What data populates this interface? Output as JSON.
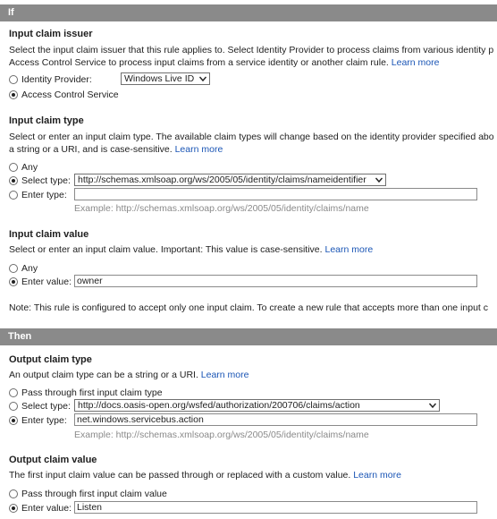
{
  "if_section": {
    "title": "If",
    "issuer": {
      "heading": "Input claim issuer",
      "desc_line1": "Select the input claim issuer that this rule applies to. Select Identity Provider to process claims from various identity p",
      "desc_line2": "Access Control Service to process input claims from a service identity or another claim rule.",
      "learn_more": "Learn more",
      "options": [
        {
          "label": "Identity Provider:",
          "checked": false
        },
        {
          "label": "Access Control Service",
          "checked": true
        }
      ],
      "provider_select": "Windows Live ID"
    },
    "claim_type": {
      "heading": "Input claim type",
      "desc_line1": "Select or enter an input claim type. The available claim types will change based on the identity provider specified abo",
      "desc_line2": "a string or a URI, and is case-sensitive.",
      "learn_more": "Learn more",
      "options": [
        {
          "label": "Any",
          "checked": false
        },
        {
          "label": "Select type:",
          "checked": true
        },
        {
          "label": "Enter type:",
          "checked": false
        }
      ],
      "select_value": "http://schemas.xmlsoap.org/ws/2005/05/identity/claims/nameidentifier",
      "enter_value": "",
      "example": "Example: http://schemas.xmlsoap.org/ws/2005/05/identity/claims/name"
    },
    "claim_value": {
      "heading": "Input claim value",
      "desc": "Select or enter an input claim value. Important: This value is case-sensitive.",
      "learn_more": "Learn more",
      "options": [
        {
          "label": "Any",
          "checked": false
        },
        {
          "label": "Enter value:",
          "checked": true
        }
      ],
      "enter_value": "owner"
    },
    "note": "Note: This rule is configured to accept only one input claim. To create a new rule that accepts more than one input c"
  },
  "then_section": {
    "title": "Then",
    "output_type": {
      "heading": "Output claim type",
      "desc": "An output claim type can be a string or a URI.",
      "learn_more": "Learn more",
      "options": [
        {
          "label": "Pass through first input claim type",
          "checked": false
        },
        {
          "label": "Select type:",
          "checked": false
        },
        {
          "label": "Enter type:",
          "checked": true
        }
      ],
      "select_value": "http://docs.oasis-open.org/wsfed/authorization/200706/claims/action",
      "enter_value": "net.windows.servicebus.action",
      "example": "Example: http://schemas.xmlsoap.org/ws/2005/05/identity/claims/name"
    },
    "output_value": {
      "heading": "Output claim value",
      "desc": "The first input claim value can be passed through or replaced with a custom value.",
      "learn_more": "Learn more",
      "options": [
        {
          "label": "Pass through first input claim value",
          "checked": false
        },
        {
          "label": "Enter value:",
          "checked": true
        }
      ],
      "enter_value": "Listen"
    }
  },
  "icons": {
    "dropdown": "chevron-down-icon",
    "radio": "radio-button-icon"
  }
}
